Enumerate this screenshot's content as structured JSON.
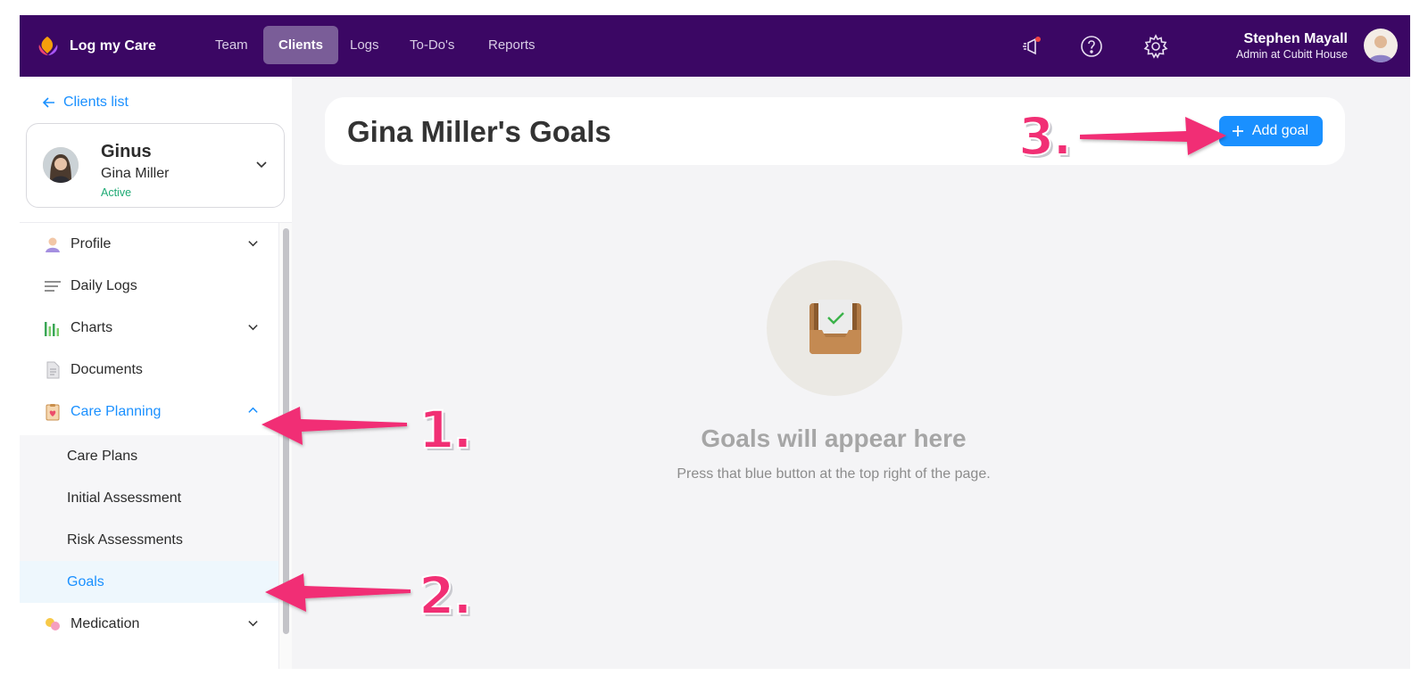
{
  "app": {
    "brand": "Log my Care"
  },
  "nav": {
    "items": [
      {
        "label": "Team"
      },
      {
        "label": "Clients"
      },
      {
        "label": "Logs"
      },
      {
        "label": "To-Do's"
      },
      {
        "label": "Reports"
      }
    ],
    "active": "Clients",
    "icons": [
      "announcement-icon",
      "help-icon",
      "settings-icon"
    ]
  },
  "user": {
    "name": "Stephen Mayall",
    "role": "Admin at Cubitt House"
  },
  "sidebar": {
    "back_label": "Clients list",
    "client": {
      "nickname": "Ginus",
      "name": "Gina Miller",
      "status": "Active"
    },
    "menu": [
      {
        "label": "Profile",
        "icon": "profile-icon"
      },
      {
        "label": "Daily Logs",
        "icon": "list-icon"
      },
      {
        "label": "Charts",
        "icon": "bar-chart-icon"
      },
      {
        "label": "Documents",
        "icon": "document-icon"
      },
      {
        "label": "Care Planning",
        "icon": "clipboard-heart-icon",
        "expanded": true
      },
      {
        "label": "Medication",
        "icon": "pills-icon"
      }
    ],
    "care_planning_children": [
      {
        "label": "Care Plans"
      },
      {
        "label": "Initial Assessment"
      },
      {
        "label": "Risk Assessments"
      },
      {
        "label": "Goals",
        "active": true
      }
    ]
  },
  "main": {
    "title": "Gina Miller's Goals",
    "add_button_label": "Add goal",
    "empty_title": "Goals will appear here",
    "empty_subtitle": "Press that blue button at the top right of the page."
  },
  "annotations": [
    {
      "label": "1."
    },
    {
      "label": "2."
    },
    {
      "label": "3."
    }
  ],
  "colors": {
    "topbar": "#3b0764",
    "accent_blue": "#1a90ff",
    "active_status": "#1eaa74",
    "annotation_pink": "#f12f74"
  }
}
